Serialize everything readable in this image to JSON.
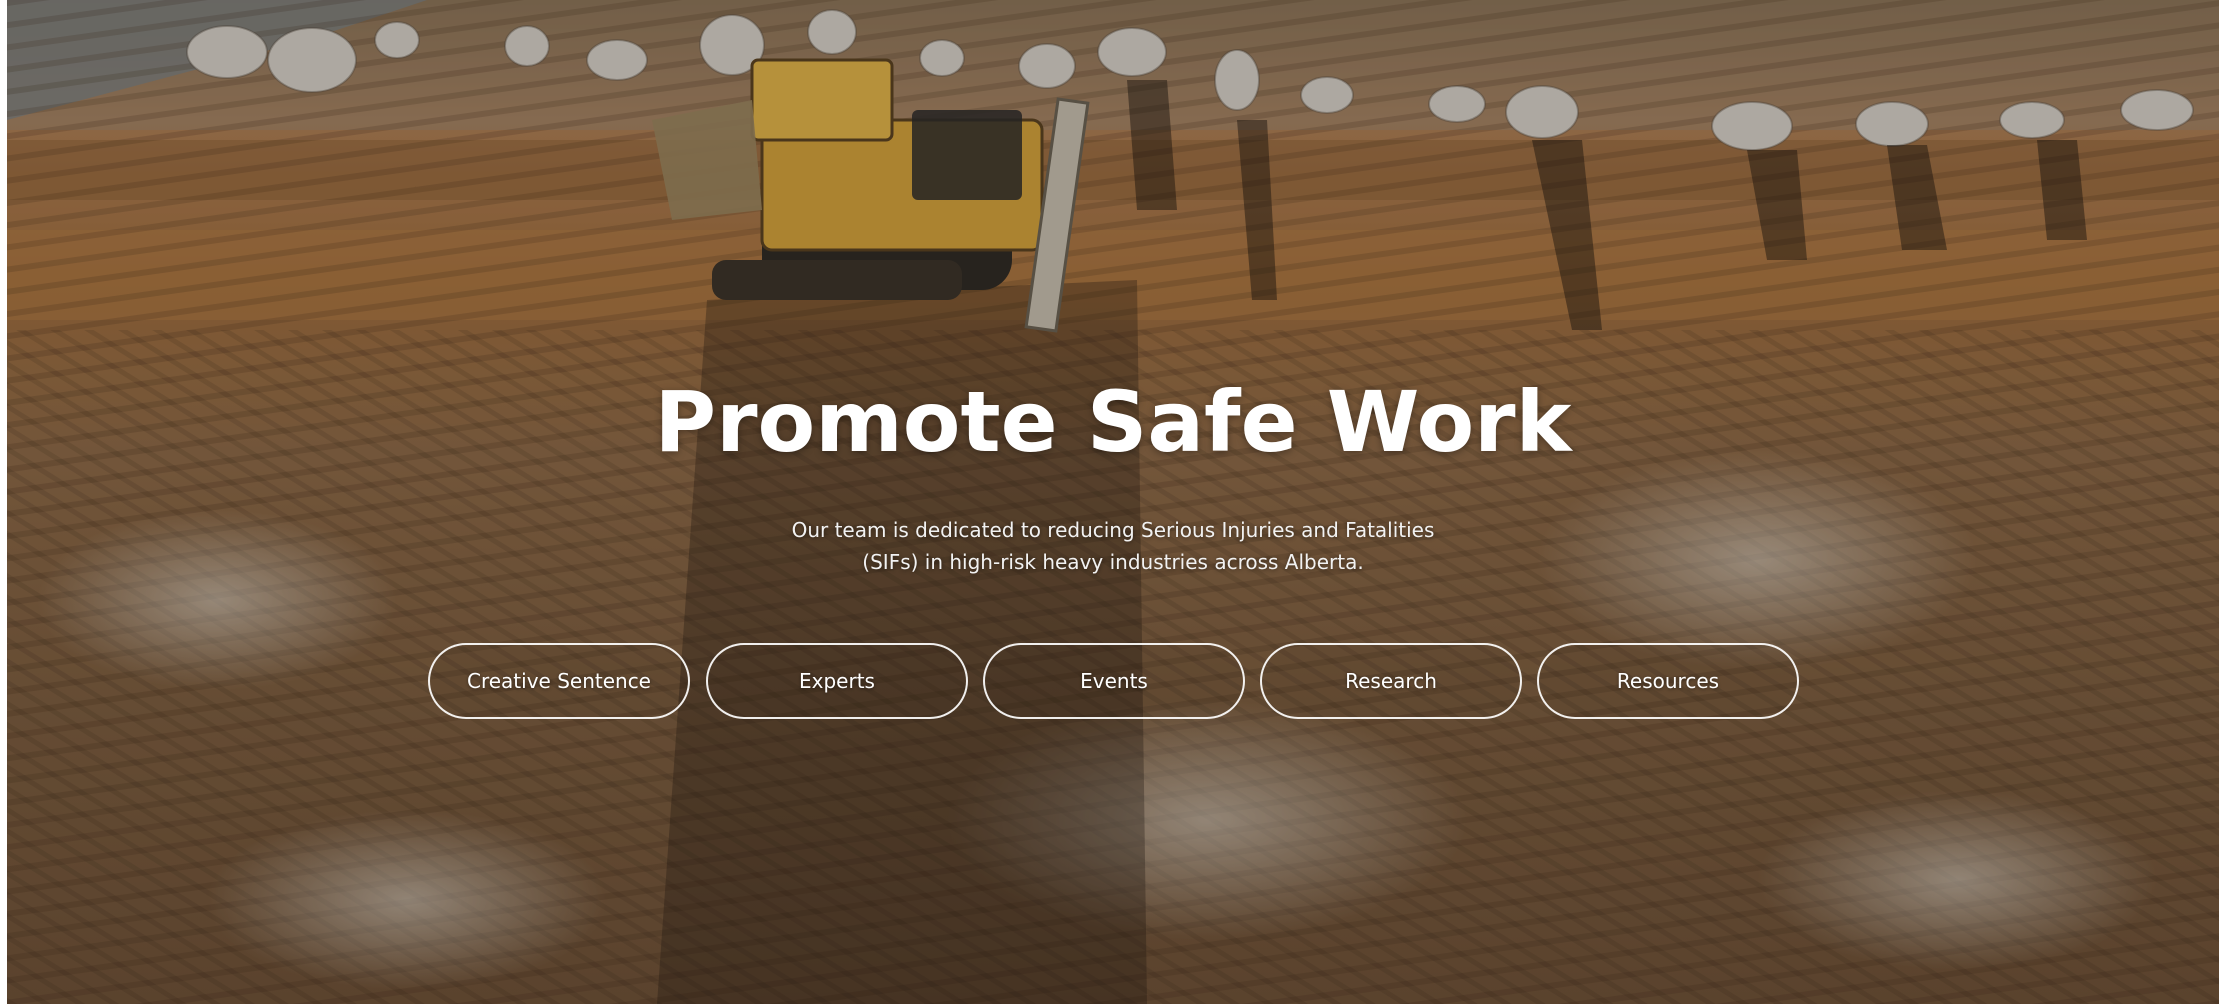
{
  "hero": {
    "title": "Promote Safe Work",
    "subtitle_line1": "Our team is dedicated to reducing Serious Injuries and Fatalities",
    "subtitle_line2": "(SIFs) in high-risk heavy industries across Alberta.",
    "background": "aerial-construction-site-with-bulldozer",
    "colors": {
      "text": "#ffffff",
      "pill_border": "#ffffff",
      "dirt": "#a0764a",
      "bulldozer": "#d6a53c"
    }
  },
  "nav": {
    "items": [
      {
        "label": "Creative Sentence"
      },
      {
        "label": "Experts"
      },
      {
        "label": "Events"
      },
      {
        "label": "Research"
      },
      {
        "label": "Resources"
      }
    ]
  }
}
